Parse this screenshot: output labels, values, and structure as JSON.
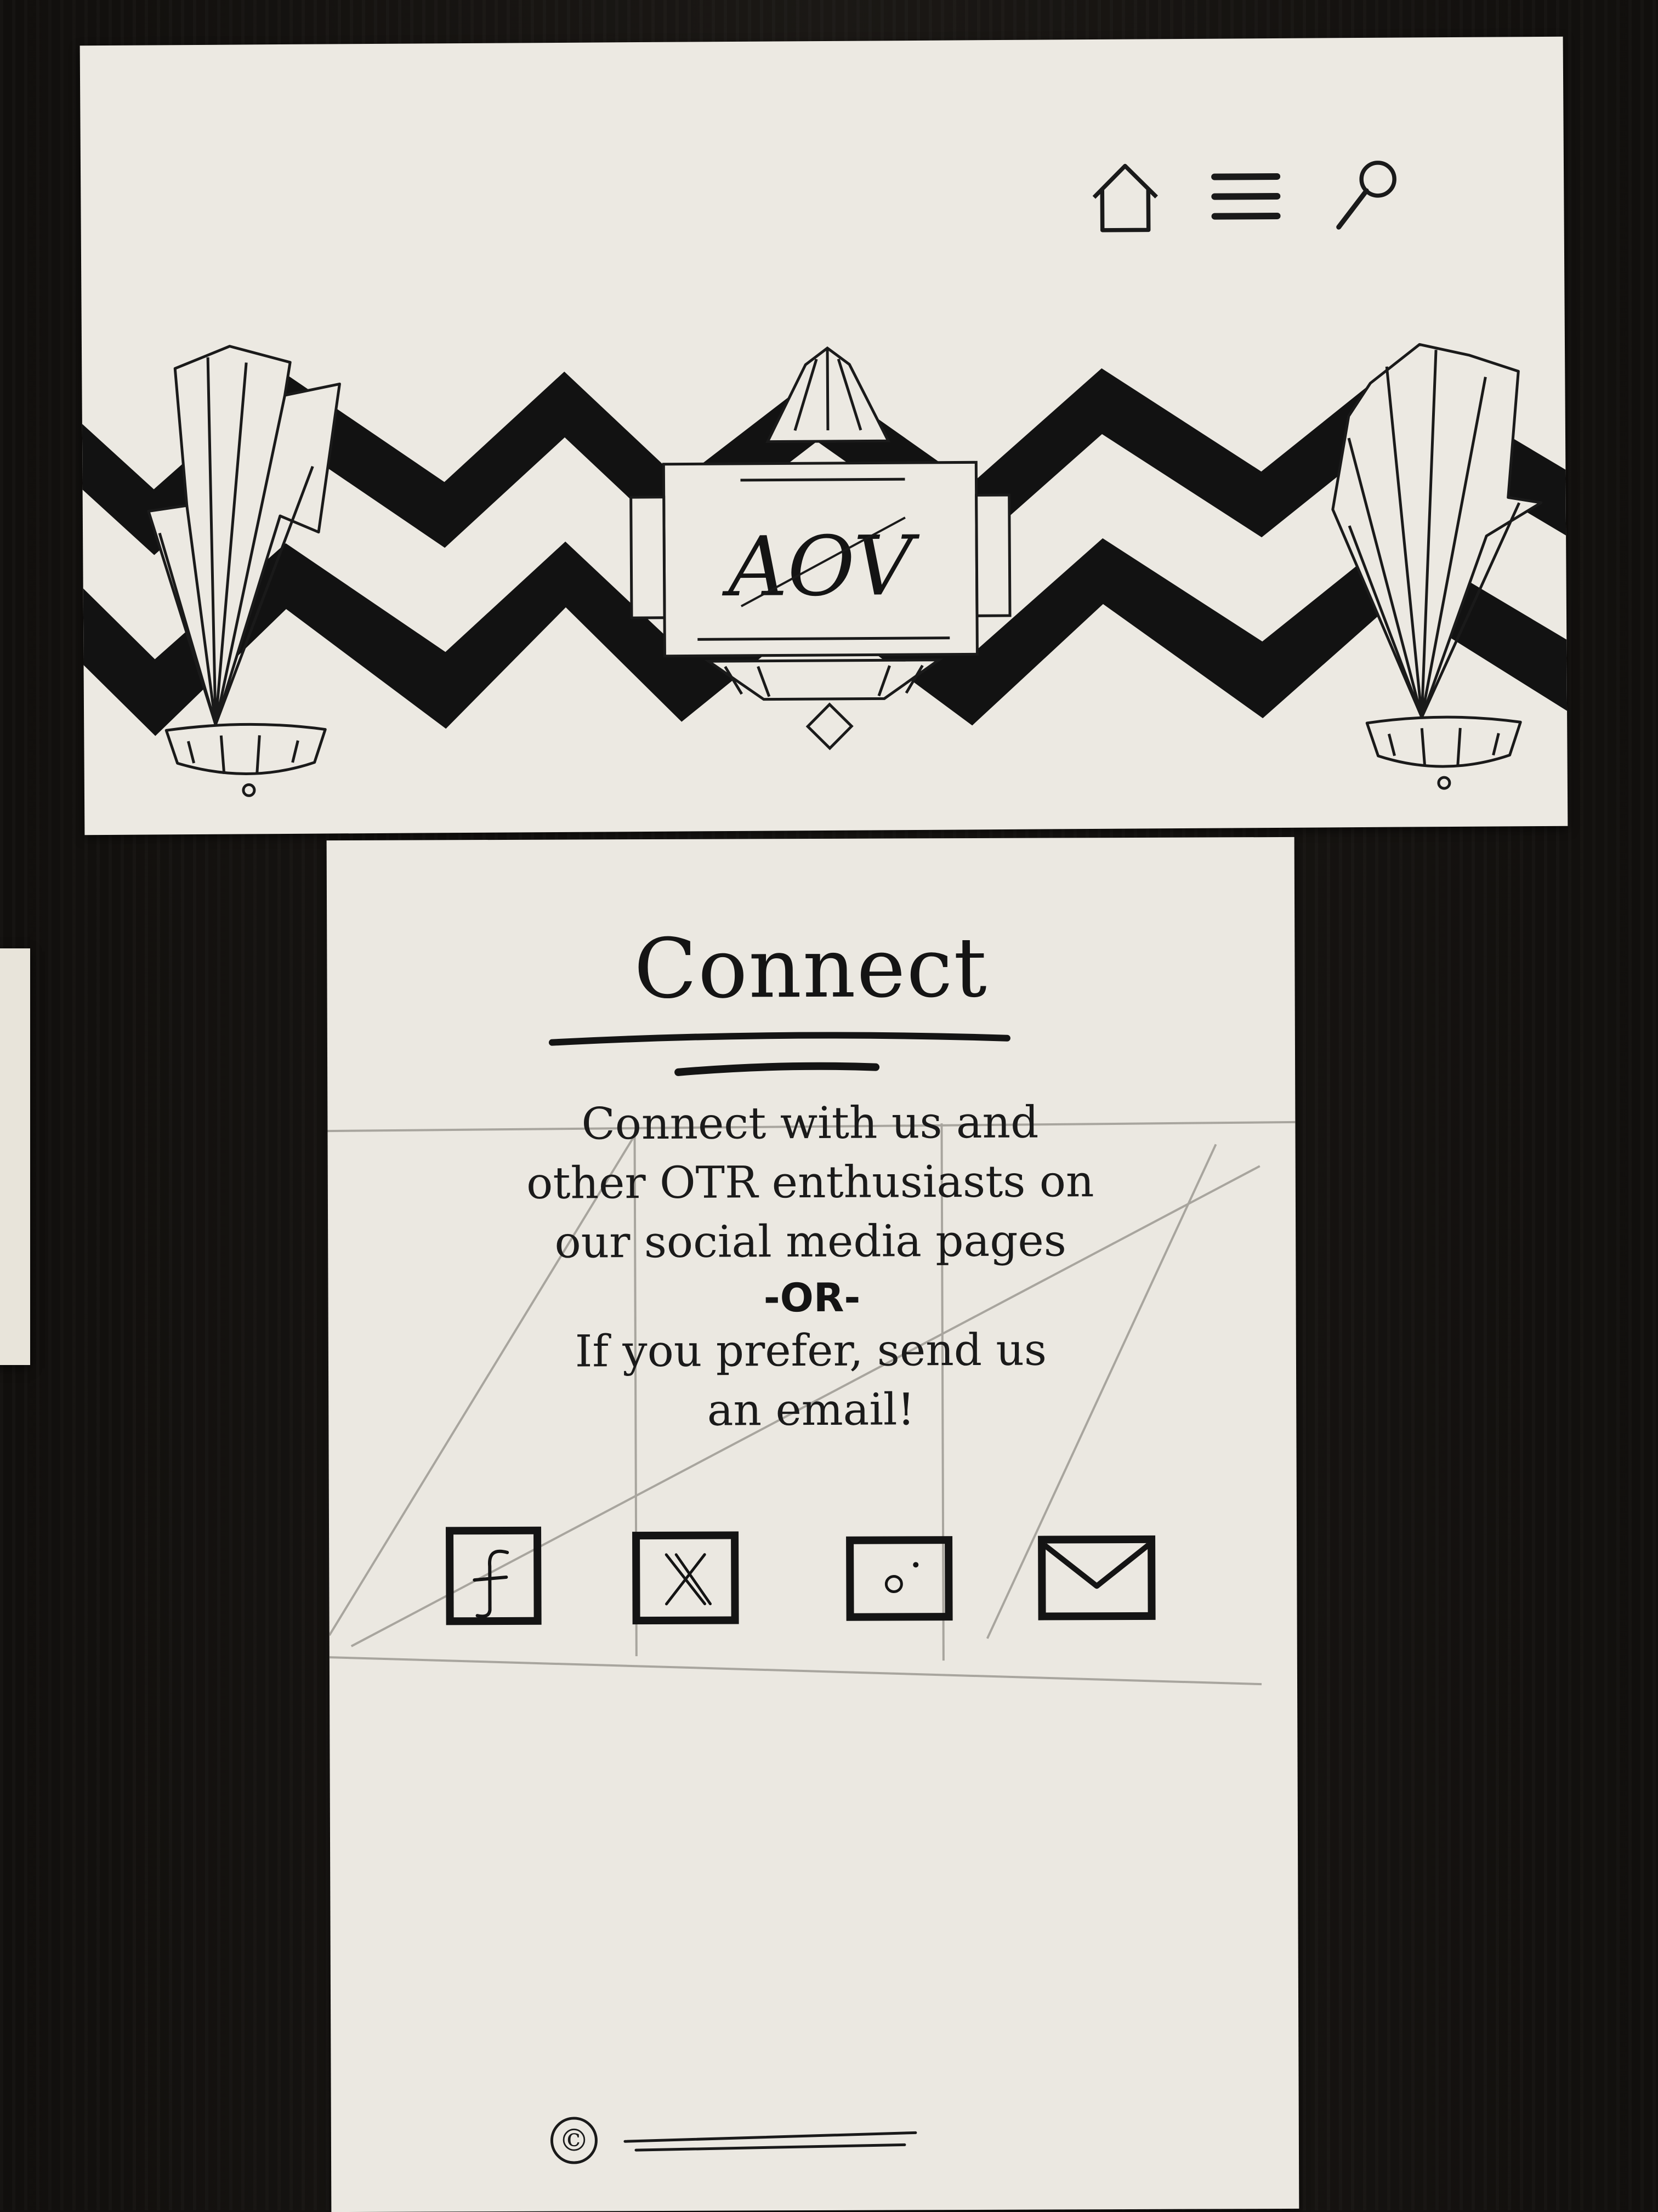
{
  "nav": {
    "home_icon": "home-icon",
    "menu_icon": "hamburger-menu-icon",
    "search_icon": "search-icon"
  },
  "logo": {
    "text": "AOV"
  },
  "page": {
    "title": "Connect",
    "blurb_line1": "Connect with us and",
    "blurb_line2": "other OTR enthusiasts on",
    "blurb_line3": "our social media pages",
    "separator": "-OR-",
    "blurb_line4": "If you prefer, send us",
    "blurb_line5": "an email!"
  },
  "social": [
    {
      "icon": "facebook-icon",
      "glyph": "f"
    },
    {
      "icon": "x-twitter-icon",
      "glyph": "X"
    },
    {
      "icon": "instagram-icon",
      "glyph": "camera"
    },
    {
      "icon": "email-envelope-icon",
      "glyph": "envelope"
    }
  ],
  "footer": {
    "copyright_symbol": "©"
  },
  "colors": {
    "paper": "#ece9e2",
    "ink": "#141414",
    "pencil": "#a8a59e",
    "background": "#141210"
  }
}
